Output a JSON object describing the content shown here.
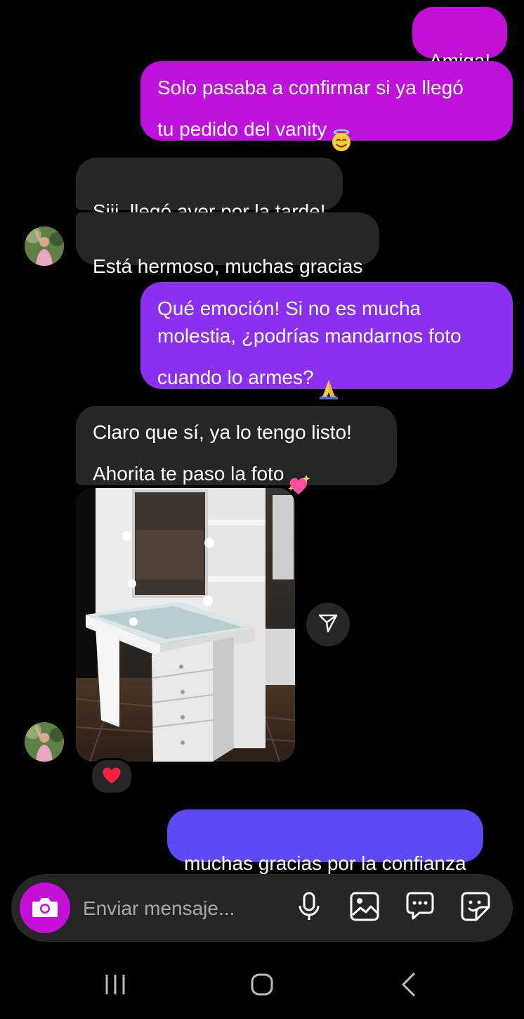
{
  "messages": {
    "m1": {
      "text": "Amiga!"
    },
    "m2": {
      "text": "Solo pasaba a confirmar si ya llegó\ntu pedido del vanity",
      "emoji": "smiling-face-with-halo"
    },
    "m3": {
      "text": "Siii, llegó ayer por la tarde!"
    },
    "m4": {
      "text": "Está hermoso, muchas gracias"
    },
    "m5": {
      "text": "Qué emoción! Si no es mucha\nmolestia, ¿podrías mandarnos foto\ncuando lo armes?",
      "emoji": "folded-hands"
    },
    "m6": {
      "text": "Claro que sí, ya lo tengo listo!\nAhorita te paso la foto",
      "emoji": "sparkling-heart"
    },
    "m7": {
      "text": "muchas gracias por la confianza"
    }
  },
  "photo": {
    "subject": "vanity-photo",
    "reaction": "red-heart"
  },
  "composer": {
    "placeholder": "Enviar mensaje..."
  },
  "icons": [
    "camera-icon",
    "microphone-icon",
    "gallery-icon",
    "chat-icon",
    "sticker-icon",
    "share-icon"
  ],
  "nav": [
    "recents-icon",
    "home-icon",
    "back-icon"
  ],
  "colors": {
    "background": "#000000",
    "received_bubble": "#262626",
    "sent_gradient_top": "#c30fd6",
    "sent_gradient_mid": "#8b2ff0",
    "sent_gradient_bottom": "#5b4bf5",
    "camera_button": "#c30fd6"
  }
}
